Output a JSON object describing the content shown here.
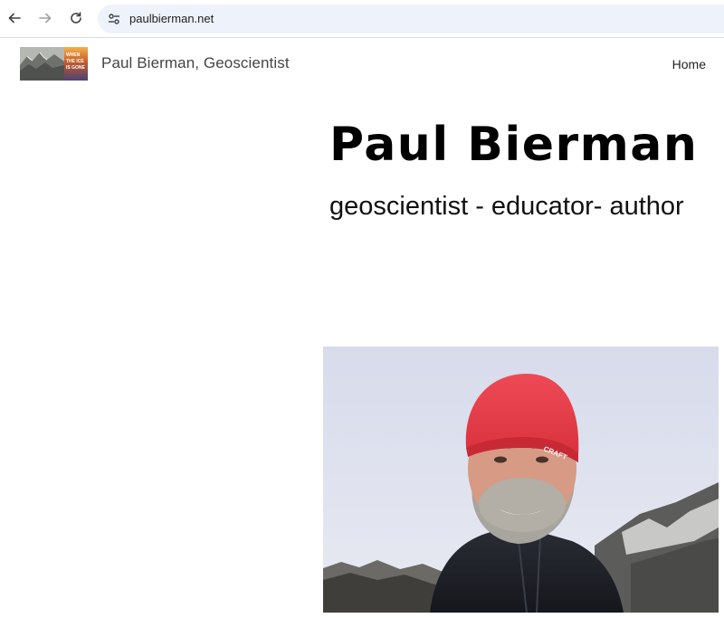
{
  "browser": {
    "url": "paulbierman.net",
    "back_icon": "arrow-left-icon",
    "forward_icon": "arrow-right-icon",
    "reload_icon": "reload-icon",
    "site_info_icon": "tune-icon"
  },
  "header": {
    "logo_alt": "When the Ice is Gone",
    "logo_book_text": [
      "WHEN",
      "THE ICE",
      "IS GONE"
    ],
    "site_title": "Paul Bierman, Geoscientist",
    "nav": [
      {
        "label": "Home"
      }
    ]
  },
  "hero": {
    "name": "Paul Bierman",
    "tagline": "geoscientist - educator- author",
    "portrait_alt": "Portrait of Paul Bierman wearing a red knit hat in a snowy mountain landscape",
    "hat_brand": "CRAFT"
  },
  "colors": {
    "hat": "#e8404a",
    "sky": "#dde1ee",
    "omnibox": "#eef2fb",
    "text": "#000000"
  }
}
